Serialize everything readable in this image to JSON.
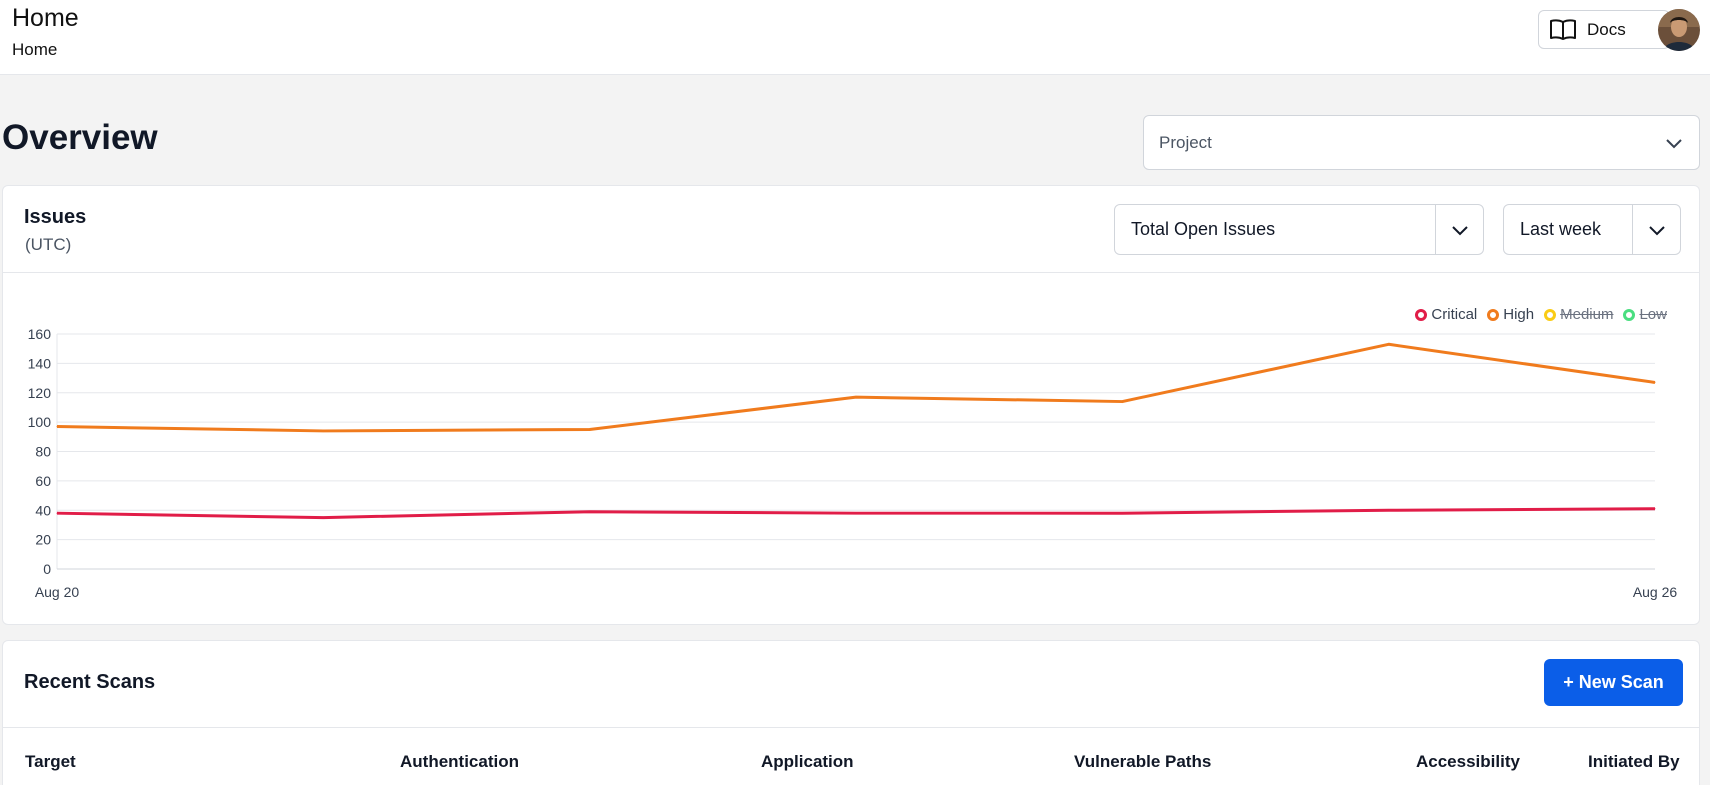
{
  "header": {
    "title": "Home",
    "breadcrumb": "Home",
    "docs_label": "Docs"
  },
  "overview": {
    "title": "Overview",
    "project_placeholder": "Project"
  },
  "issues": {
    "title": "Issues",
    "subtitle": "(UTC)",
    "metric_select": "Total Open Issues",
    "range_select": "Last week"
  },
  "chart_data": {
    "type": "line",
    "x": [
      "Aug 20",
      "Aug 21",
      "Aug 22",
      "Aug 23",
      "Aug 24",
      "Aug 25",
      "Aug 26"
    ],
    "x_tick_labels": [
      "Aug 20",
      "Aug 26"
    ],
    "ylim": [
      0,
      160
    ],
    "y_ticks": [
      0,
      20,
      40,
      60,
      80,
      100,
      120,
      140,
      160
    ],
    "grid": true,
    "legend_position": "top-right",
    "series": [
      {
        "name": "Critical",
        "color": "#e11d48",
        "visible": true,
        "values": [
          38,
          35,
          39,
          38,
          38,
          40,
          41
        ]
      },
      {
        "name": "High",
        "color": "#f07b1d",
        "visible": true,
        "values": [
          97,
          94,
          95,
          117,
          114,
          153,
          127
        ]
      },
      {
        "name": "Medium",
        "color": "#facc15",
        "visible": false,
        "values": []
      },
      {
        "name": "Low",
        "color": "#4ade80",
        "visible": false,
        "values": []
      }
    ]
  },
  "scans": {
    "title": "Recent Scans",
    "new_scan_label": "+ New Scan",
    "columns": [
      "Target",
      "Authentication",
      "Application",
      "Vulnerable Paths",
      "Accessibility",
      "Initiated By"
    ]
  },
  "icons": {
    "docs": "book-open-icon",
    "chevron": "chevron-down-icon",
    "avatar": "user-avatar"
  }
}
